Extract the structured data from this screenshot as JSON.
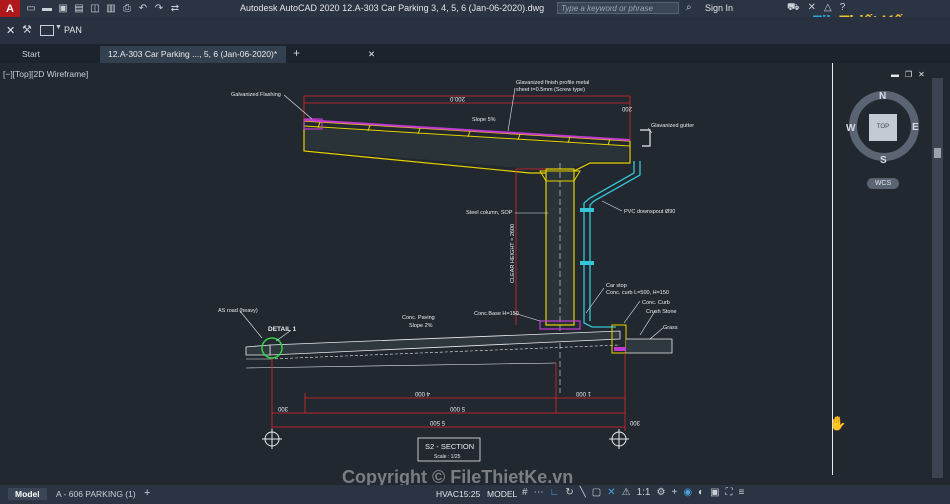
{
  "app": {
    "title": "Autodesk AutoCAD 2020    12.A-303 Car Parking 3, 4, 5, 6 (Jan-06-2020).dwg",
    "logo_letter": "A",
    "search_placeholder": "Type a keyword or phrase",
    "sign_in": "Sign In",
    "watermark_brand_a": "File",
    "watermark_brand_b": "Thiết Kế",
    "watermark_brand_c": ".vn"
  },
  "command": {
    "current": "PAN"
  },
  "tabs": [
    {
      "label": "Start"
    },
    {
      "label": "12.A-303 Car Parking ..., 5, 6 (Jan-06-2020)*"
    }
  ],
  "viewport": {
    "label": "[−][Top][2D Wireframe]",
    "viewcube": {
      "n": "N",
      "s": "S",
      "e": "E",
      "w": "W",
      "top": "TOP",
      "wcs": "WCS"
    }
  },
  "drawing": {
    "labels": {
      "galvanized_flashing": "Galvanized Flashing",
      "finish_profile_1": "Glavanized finish profile metal",
      "finish_profile_2": "sheet t=0.5mm (Screw type)",
      "galvanized_gutter": "Glavanized gutter",
      "slope_roof": "Slope 5%",
      "steel_column": "Steel column, SOP",
      "downspout": "PVC downspout Ø90",
      "clear_height": "CLEAR HEIGHT = 2600",
      "car_stop_1": "Car stop",
      "car_stop_2": "Conc. curb L=500, H=150",
      "conc_curb": "Conc. Curb",
      "crush_stone": "Crush Stone",
      "grass": "Grass",
      "as_road": "AS road (heavy)",
      "detail": "DETAIL 1",
      "paving": "Conc. Paving",
      "slope_paving": "Slope 2%",
      "conc_base": "Conc.Base H=150",
      "dim_top_1": "200",
      "dim_top_2": "200.0",
      "dim_right": "200",
      "dim_4000": "4 000",
      "dim_1000": "1 000",
      "dim_5000": "5 000",
      "dim_5500": "5 500",
      "dim_300": "300",
      "section_title": "S2 - SECTION",
      "section_scale": "Scale : 1/25"
    }
  },
  "status": {
    "model_tab": "Model",
    "layout_tab": "A - 606 PARKING (1)",
    "coord": "HVAC15:25",
    "space": "MODEL",
    "scale": "1:1"
  },
  "copyright": "Copyright © FileThietKe.vn",
  "colors": {
    "background": "#212830",
    "roof": "#e8d200",
    "magenta": "#c33ad3",
    "red": "#e0262a",
    "cyan": "#35c6d8",
    "green": "#34d24a"
  }
}
